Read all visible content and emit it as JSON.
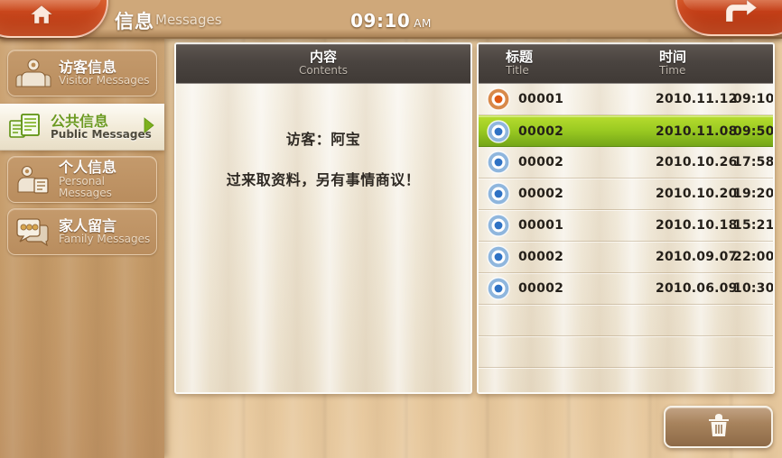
{
  "header": {
    "title_cn": "信息",
    "title_en": "Messages",
    "clock_time": "09:10",
    "clock_ampm": "AM",
    "home_icon": "home-icon",
    "return_icon": "return-arrow-icon"
  },
  "sidebar": {
    "items": [
      {
        "cn": "访客信息",
        "en": "Visitor Messages",
        "icon": "visitor-group-icon",
        "selected": false
      },
      {
        "cn": "公共信息",
        "en": "Public Messages",
        "icon": "public-document-icon",
        "selected": true
      },
      {
        "cn": "个人信息",
        "en": "Personal Messages",
        "icon": "person-document-icon",
        "selected": false
      },
      {
        "cn": "家人留言",
        "en": "Family Messages",
        "icon": "speech-bubble-icon",
        "selected": false
      }
    ]
  },
  "contents_panel": {
    "head_cn": "内容",
    "head_en": "Contents",
    "lines": [
      "访客：阿宝",
      "过来取资料，另有事情商议！"
    ]
  },
  "list_panel": {
    "head_title_cn": "标题",
    "head_title_en": "Title",
    "head_time_cn": "时间",
    "head_time_en": "Time",
    "rows": [
      {
        "title": "00001",
        "date": "2010.11.12",
        "time": "09:10",
        "icon": "unread-dot-icon",
        "status": "unread",
        "selected": false
      },
      {
        "title": "00002",
        "date": "2010.11.08",
        "time": "09:50",
        "icon": "read-dot-icon",
        "status": "read",
        "selected": true
      },
      {
        "title": "00002",
        "date": "2010.10.26",
        "time": "17:58",
        "icon": "read-dot-icon",
        "status": "read",
        "selected": false
      },
      {
        "title": "00002",
        "date": "2010.10.20",
        "time": "19:20",
        "icon": "read-dot-icon",
        "status": "read",
        "selected": false
      },
      {
        "title": "00001",
        "date": "2010.10.18",
        "time": "15:21",
        "icon": "read-dot-icon",
        "status": "read",
        "selected": false
      },
      {
        "title": "00002",
        "date": "2010.09.07",
        "time": "22:00",
        "icon": "read-dot-icon",
        "status": "read",
        "selected": false
      },
      {
        "title": "00002",
        "date": "2010.06.09",
        "time": "10:30",
        "icon": "read-dot-icon",
        "status": "read",
        "selected": false
      }
    ],
    "empty_row_count": 3
  },
  "footer": {
    "delete_icon": "trash-icon"
  },
  "colors": {
    "accent_orange": "#c8461c",
    "selected_green": "#9ccb22",
    "unread_dot": "#e05a14",
    "read_dot": "#2f72c4",
    "panel_header": "#4a4440",
    "wood_light": "#e6c79a",
    "wood_sidebar": "#c49a6c"
  }
}
